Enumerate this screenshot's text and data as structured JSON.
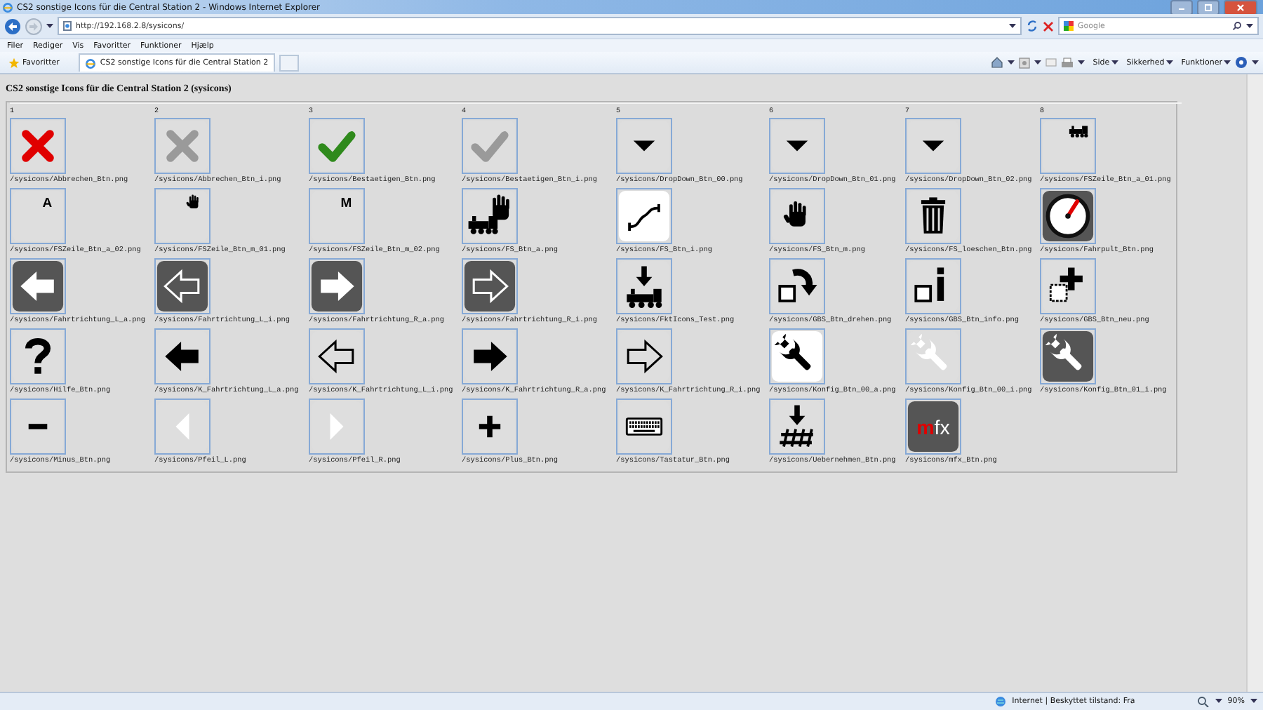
{
  "window": {
    "title": "CS2 sonstige Icons für die Central Station 2 - Windows Internet Explorer"
  },
  "address_bar": {
    "url": "http://192.168.2.8/sysicons/"
  },
  "search": {
    "placeholder": "Google"
  },
  "menu": [
    "Filer",
    "Rediger",
    "Vis",
    "Favoritter",
    "Funktioner",
    "Hjælp"
  ],
  "favorites_bar": {
    "label": "Favoritter",
    "tabs": [
      {
        "title": "CS2 sonstige Icons für die Central Station 2",
        "selected": true
      }
    ]
  },
  "command_bar": [
    "Side",
    "Sikkerhed",
    "Funktioner"
  ],
  "page": {
    "heading": "CS2 sonstige Icons für die Central Station 2 (sysicons)",
    "columns": [
      "1",
      "2",
      "3",
      "4",
      "5",
      "6",
      "7",
      "8"
    ],
    "icons": [
      {
        "file": "/sysicons/Abbrechen_Btn.png",
        "kind": "cross",
        "dark": false,
        "white": false,
        "color": "#e00000"
      },
      {
        "file": "/sysicons/Abbrechen_Btn_i.png",
        "kind": "cross",
        "dark": false,
        "white": false,
        "color": "#9a9a9a"
      },
      {
        "file": "/sysicons/Bestaetigen_Btn.png",
        "kind": "check",
        "dark": false,
        "white": false,
        "color": "#2f8a1c"
      },
      {
        "file": "/sysicons/Bestaetigen_Btn_i.png",
        "kind": "check",
        "dark": false,
        "white": false,
        "color": "#9a9a9a"
      },
      {
        "file": "/sysicons/DropDown_Btn_00.png",
        "kind": "dropdown",
        "dark": false,
        "white": false,
        "color": "#000000"
      },
      {
        "file": "/sysicons/DropDown_Btn_01.png",
        "kind": "dropdown",
        "dark": false,
        "white": false,
        "color": "#000000"
      },
      {
        "file": "/sysicons/DropDown_Btn_02.png",
        "kind": "dropdown",
        "dark": false,
        "white": false,
        "color": "#000000"
      },
      {
        "file": "/sysicons/FSZeile_Btn_a_01.png",
        "kind": "train-corner",
        "dark": false,
        "white": false,
        "color": "#000000"
      },
      {
        "file": "/sysicons/FSZeile_Btn_a_02.png",
        "kind": "letter",
        "dark": false,
        "white": false,
        "glyph": [
          {
            "text": "A",
            "color": "#000000"
          }
        ]
      },
      {
        "file": "/sysicons/FSZeile_Btn_m_01.png",
        "kind": "hand-corner",
        "dark": false,
        "white": false,
        "color": "#000000"
      },
      {
        "file": "/sysicons/FSZeile_Btn_m_02.png",
        "kind": "letter",
        "dark": false,
        "white": false,
        "glyph": [
          {
            "text": "M",
            "color": "#000000"
          }
        ]
      },
      {
        "file": "/sysicons/FS_Btn_a.png",
        "kind": "train-hand",
        "dark": false,
        "white": false,
        "color": "#000000"
      },
      {
        "file": "/sysicons/FS_Btn_i.png",
        "kind": "route",
        "dark": false,
        "white": true,
        "color": "#000000"
      },
      {
        "file": "/sysicons/FS_Btn_m.png",
        "kind": "hand",
        "dark": false,
        "white": false,
        "color": "#000000"
      },
      {
        "file": "/sysicons/FS_loeschen_Btn.png",
        "kind": "trash",
        "dark": false,
        "white": false,
        "color": "#000000"
      },
      {
        "file": "/sysicons/Fahrpult_Btn.png",
        "kind": "gauge",
        "dark": true,
        "white": false,
        "color": "#e00000"
      },
      {
        "file": "/sysicons/Fahrtrichtung_L_a.png",
        "kind": "arrow-left",
        "dark": true,
        "white": false,
        "color": "#ffffff",
        "outline": false
      },
      {
        "file": "/sysicons/Fahrtrichtung_L_i.png",
        "kind": "arrow-left",
        "dark": true,
        "white": false,
        "color": "#ffffff",
        "outline": true
      },
      {
        "file": "/sysicons/Fahrtrichtung_R_a.png",
        "kind": "arrow-right",
        "dark": true,
        "white": false,
        "color": "#ffffff",
        "outline": false
      },
      {
        "file": "/sysicons/Fahrtrichtung_R_i.png",
        "kind": "arrow-right",
        "dark": true,
        "white": false,
        "color": "#ffffff",
        "outline": true
      },
      {
        "file": "/sysicons/FktIcons_Test.png",
        "kind": "train-down",
        "dark": false,
        "white": false,
        "color": "#000000"
      },
      {
        "file": "/sysicons/GBS_Btn_drehen.png",
        "kind": "rotate",
        "dark": false,
        "white": false,
        "color": "#000000"
      },
      {
        "file": "/sysicons/GBS_Btn_info.png",
        "kind": "info",
        "dark": false,
        "white": false,
        "color": "#000000"
      },
      {
        "file": "/sysicons/GBS_Btn_neu.png",
        "kind": "new",
        "dark": false,
        "white": false,
        "color": "#000000"
      },
      {
        "file": "/sysicons/Hilfe_Btn.png",
        "kind": "question",
        "dark": false,
        "white": false,
        "color": "#000000"
      },
      {
        "file": "/sysicons/K_Fahrtrichtung_L_a.png",
        "kind": "arrow-left",
        "dark": false,
        "white": false,
        "color": "#000000",
        "outline": false
      },
      {
        "file": "/sysicons/K_Fahrtrichtung_L_i.png",
        "kind": "arrow-left",
        "dark": false,
        "white": false,
        "color": "#000000",
        "outline": true
      },
      {
        "file": "/sysicons/K_Fahrtrichtung_R_a.png",
        "kind": "arrow-right",
        "dark": false,
        "white": false,
        "color": "#000000",
        "outline": false
      },
      {
        "file": "/sysicons/K_Fahrtrichtung_R_i.png",
        "kind": "arrow-right",
        "dark": false,
        "white": false,
        "color": "#000000",
        "outline": true
      },
      {
        "file": "/sysicons/Konfig_Btn_00_a.png",
        "kind": "wrench",
        "dark": false,
        "white": true,
        "color": "#000000"
      },
      {
        "file": "/sysicons/Konfig_Btn_00_i.png",
        "kind": "wrench",
        "dark": false,
        "white": false,
        "color": "#ffffff"
      },
      {
        "file": "/sysicons/Konfig_Btn_01_i.png",
        "kind": "wrench",
        "dark": true,
        "white": false,
        "color": "#ffffff"
      },
      {
        "file": "/sysicons/Minus_Btn.png",
        "kind": "minus",
        "dark": false,
        "white": false,
        "color": "#000000"
      },
      {
        "file": "/sysicons/Pfeil_L.png",
        "kind": "triangle-left",
        "dark": false,
        "white": false,
        "color": "#ffffff"
      },
      {
        "file": "/sysicons/Pfeil_R.png",
        "kind": "triangle-right",
        "dark": false,
        "white": false,
        "color": "#ffffff"
      },
      {
        "file": "/sysicons/Plus_Btn.png",
        "kind": "plus",
        "dark": false,
        "white": false,
        "color": "#000000"
      },
      {
        "file": "/sysicons/Tastatur_Btn.png",
        "kind": "keyboard",
        "dark": false,
        "white": false,
        "color": "#000000"
      },
      {
        "file": "/sysicons/Uebernehmen_Btn.png",
        "kind": "track-down",
        "dark": false,
        "white": false,
        "color": "#000000"
      },
      {
        "file": "/sysicons/mfx_Btn.png",
        "kind": "letter",
        "dark": true,
        "white": false,
        "glyph": [
          {
            "text": "m",
            "color": "#e00000"
          },
          {
            "text": "fx",
            "color": "#ffffff"
          }
        ]
      }
    ]
  },
  "status_bar": {
    "zone": "Internet | Beskyttet tilstand: Fra",
    "zoom": "90%"
  }
}
